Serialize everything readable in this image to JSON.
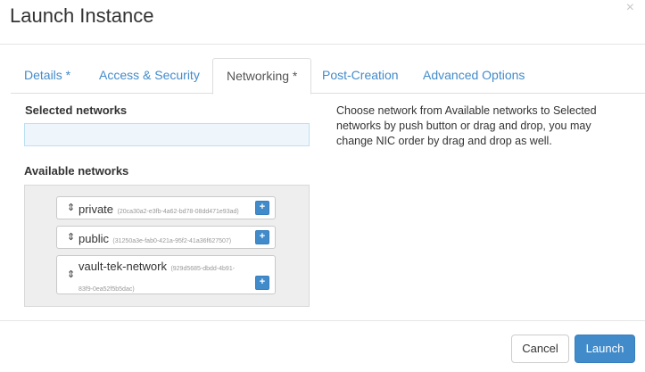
{
  "modal": {
    "title": "Launch Instance",
    "close": "×"
  },
  "tabs": [
    {
      "label": "Details *"
    },
    {
      "label": "Access & Security"
    },
    {
      "label": "Networking *"
    },
    {
      "label": "Post-Creation"
    },
    {
      "label": "Advanced Options"
    }
  ],
  "active_tab": "Networking *",
  "selected_networks": {
    "label": "Selected networks"
  },
  "available_networks": {
    "label": "Available networks",
    "items": [
      {
        "name": "private",
        "id": "(20ca30a2-e3fb-4a62-bd78-08dd471e93ad)"
      },
      {
        "name": "public",
        "id": "(31250a3e-fab0-421a-95f2-41a36f627507)"
      },
      {
        "name": "vault-tek-network",
        "id": "(929d5685-dbdd-4b91-83f9-0ea52f5b5dac)"
      }
    ],
    "add_symbol": "+",
    "sort_symbol": "⇕"
  },
  "help_text": "Choose network from Available networks to Selected networks by push button or drag and drop, you may change NIC order by drag and drop as well.",
  "buttons": {
    "cancel": "Cancel",
    "launch": "Launch"
  },
  "colors": {
    "link": "#428bca",
    "primary": "#428bca",
    "selected_box_bg": "#eef6fc"
  }
}
